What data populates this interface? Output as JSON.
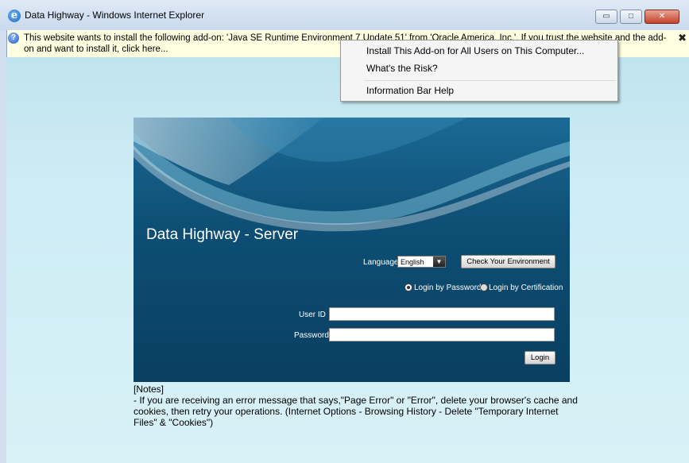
{
  "window": {
    "title": "Data Highway - Windows Internet Explorer",
    "minimize": "▭",
    "maximize": "□",
    "close": "✕"
  },
  "infobar": {
    "text": "This website wants to install the following add-on: 'Java SE Runtime Environment 7 Update 51' from 'Oracle America, Inc.'. If you trust the website and the add-on and want to install it, click here...",
    "close": "✖"
  },
  "menu": {
    "items": [
      "Install This Add-on for All Users on This Computer...",
      "What's the Risk?",
      "Information Bar Help"
    ]
  },
  "login": {
    "title": "Data Highway - Server",
    "language_label": "Language",
    "language_value": "English",
    "check_env_button": "Check Your Environment",
    "radio_password": "Login by Password",
    "radio_certification": "Login by Certification",
    "selected_method": "password",
    "user_id_label": "User ID",
    "password_label": "Password",
    "user_id_value": "",
    "password_value": "",
    "login_button": "Login"
  },
  "notes": {
    "heading": "[Notes]",
    "body": "- If you are receiving an error message that says,\"Page Error\" or \"Error\", delete your browser's cache and cookies, then retry your operations. (Internet Options - Browsing History - Delete \"Temporary Internet Files\" & \"Cookies\")"
  },
  "colors": {
    "panel": "#0e4f75",
    "infobar": "#ffffe1",
    "page_background": "#cdecf4"
  }
}
